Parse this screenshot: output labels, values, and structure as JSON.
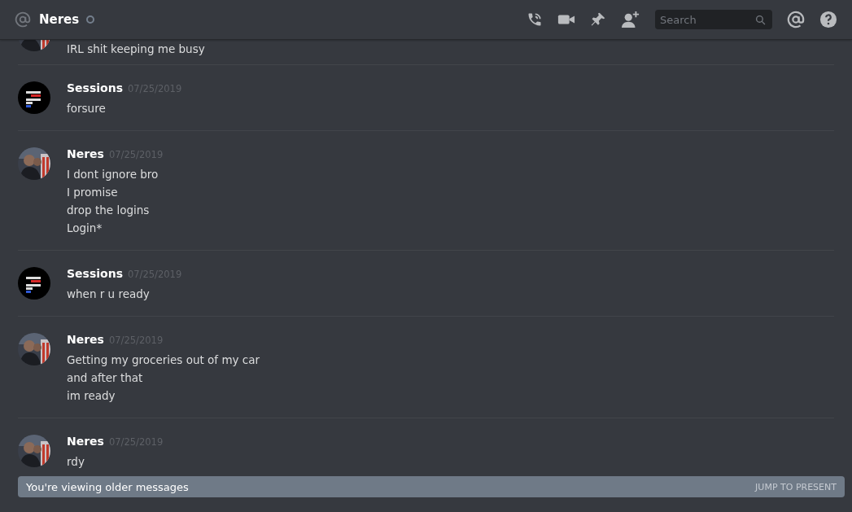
{
  "header": {
    "title": "Neres",
    "online": false,
    "search": {
      "placeholder": "Search"
    }
  },
  "messages": [
    {
      "partial": true,
      "lines": [
        "IRL shit keeping me busy"
      ]
    },
    {
      "partial": false,
      "author": "Sessions",
      "time": "07/25/2019",
      "lines": [
        "forsure"
      ]
    },
    {
      "partial": false,
      "author": "Neres",
      "time": "07/25/2019",
      "lines": [
        "I dont ignore bro",
        "I promise",
        "drop the logins",
        "Login*"
      ]
    },
    {
      "partial": false,
      "author": "Sessions",
      "time": "07/25/2019",
      "lines": [
        "when r u ready"
      ]
    },
    {
      "partial": false,
      "author": "Neres",
      "time": "07/25/2019",
      "lines": [
        "Getting my groceries out of my car",
        "and after that",
        "im ready"
      ]
    },
    {
      "partial": false,
      "author": "Neres",
      "time": "07/25/2019",
      "lines": [
        "rdy"
      ]
    }
  ],
  "banner": {
    "text": "You're viewing older messages",
    "action": "JUMP TO PRESENT"
  }
}
